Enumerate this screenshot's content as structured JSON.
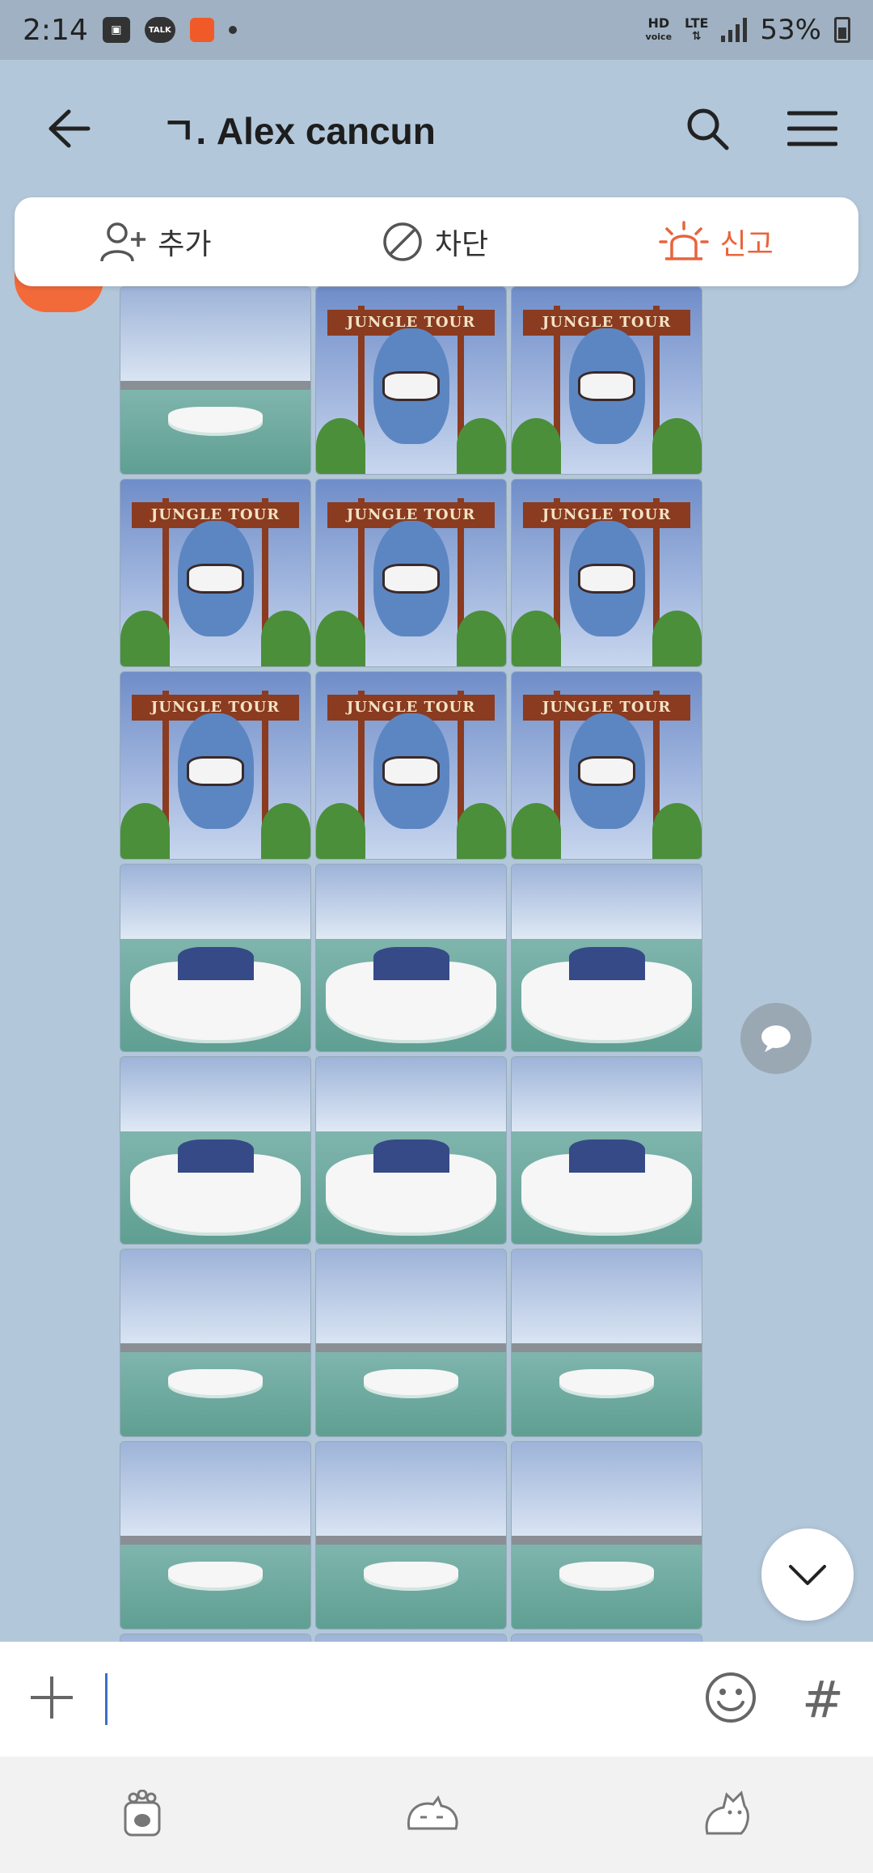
{
  "status_bar": {
    "time": "2:14",
    "talk_label": "TALK",
    "hd_label": "HD",
    "voice_label": "voice",
    "lte_label": "LTE",
    "battery": "53%"
  },
  "header": {
    "title": "ㄱ. Alex cancun"
  },
  "action_bar": {
    "add_label": "추가",
    "block_label": "차단",
    "report_label": "신고"
  },
  "photos": {
    "sign_text": "JUNGLE TOUR",
    "grid": [
      "boat-far",
      "shark",
      "shark",
      "shark",
      "shark",
      "shark",
      "shark",
      "shark",
      "shark",
      "boat-close",
      "boat-close",
      "boat-close",
      "boat-close",
      "boat-close",
      "boat-close",
      "boat-far",
      "boat-far",
      "boat-far",
      "boat-far",
      "boat-far",
      "boat-far",
      "boat-far",
      "boat-far",
      "boat-far"
    ]
  },
  "input": {
    "value": ""
  },
  "colors": {
    "chat_background": "#b2c7da",
    "report_accent": "#e8643c",
    "avatar": "#f26a3a"
  },
  "icons": {
    "back": "arrow-left-icon",
    "search": "search-icon",
    "menu": "hamburger-menu-icon",
    "add_friend": "person-add-icon",
    "block": "block-icon",
    "report": "siren-icon",
    "plus": "plus-icon",
    "emoji": "emoji-icon",
    "hashtag": "hashtag-icon"
  }
}
